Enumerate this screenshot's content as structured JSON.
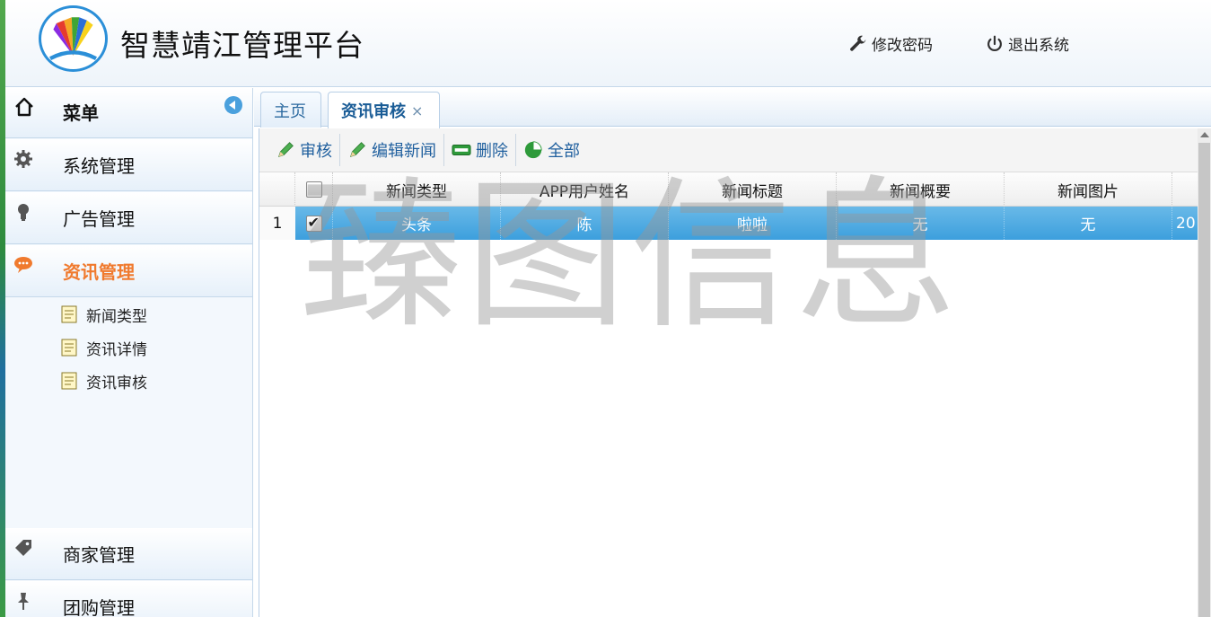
{
  "header": {
    "title": "智慧靖江管理平台",
    "logo_icon": "fan-logo-icon",
    "change_password_label": "修改密码",
    "logout_label": "退出系统"
  },
  "sidebar": {
    "menu_label": "菜单",
    "items": [
      {
        "label": "系统管理",
        "icon": "gear-icon"
      },
      {
        "label": "广告管理",
        "icon": "bulb-icon"
      },
      {
        "label": "资讯管理",
        "icon": "chat-bubble-icon",
        "active": true
      },
      {
        "label": "商家管理",
        "icon": "tag-icon"
      },
      {
        "label": "团购管理",
        "icon": "pin-icon"
      }
    ],
    "sub_items": [
      {
        "label": "新闻类型"
      },
      {
        "label": "资讯详情"
      },
      {
        "label": "资讯审核"
      }
    ]
  },
  "tabs": [
    {
      "label": "主页"
    },
    {
      "label": "资讯审核",
      "active": true,
      "close": "×"
    }
  ],
  "toolbar": {
    "audit_label": "审核",
    "edit_label": "编辑新闻",
    "delete_label": "删除",
    "all_label": "全部"
  },
  "table": {
    "columns": [
      "新闻类型",
      "APP用户姓名",
      "新闻标题",
      "新闻概要",
      "新闻图片"
    ],
    "rows": [
      {
        "num": "1",
        "checked": true,
        "cells": [
          "头条",
          "陈",
          "啦啦",
          "无",
          "无",
          "20"
        ]
      }
    ]
  },
  "watermark": "臻图信息",
  "colors": {
    "accent": "#3c9fdd",
    "active_menu": "#f07a2e",
    "link": "#1f5f9e"
  }
}
